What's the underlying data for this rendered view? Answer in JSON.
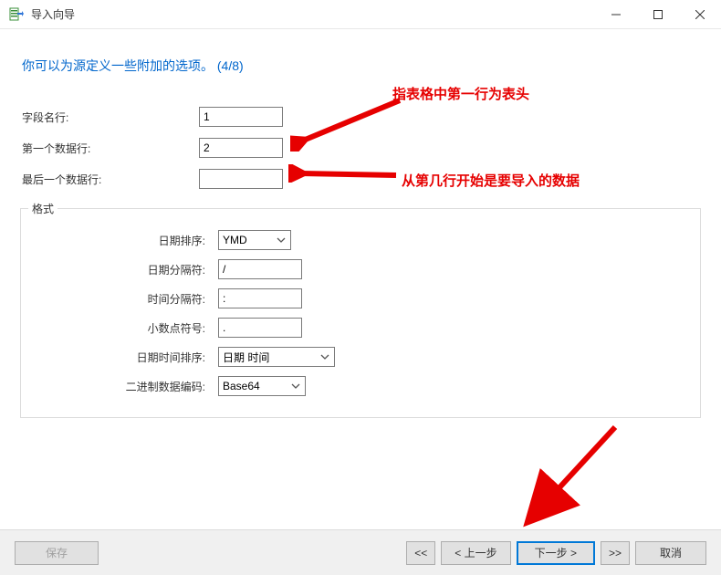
{
  "window": {
    "title": "导入向导"
  },
  "instruction": "你可以为源定义一些附加的选项。 (4/8)",
  "row_config": {
    "field_name_row_label": "字段名行:",
    "field_name_row_value": "1",
    "first_data_row_label": "第一个数据行:",
    "first_data_row_value": "2",
    "last_data_row_label": "最后一个数据行:",
    "last_data_row_value": ""
  },
  "format": {
    "legend": "格式",
    "date_order_label": "日期排序:",
    "date_order_value": "YMD",
    "date_delim_label": "日期分隔符:",
    "date_delim_value": "/",
    "time_delim_label": "时间分隔符:",
    "time_delim_value": ":",
    "decimal_label": "小数点符号:",
    "decimal_value": ".",
    "datetime_order_label": "日期时间排序:",
    "datetime_order_value": "日期 时间",
    "binary_enc_label": "二进制数据编码:",
    "binary_enc_value": "Base64"
  },
  "annotations": {
    "note1": "指表格中第一行为表头",
    "note2": "从第几行开始是要导入的数据"
  },
  "buttons": {
    "save": "保存",
    "first": "<<",
    "prev": "< 上一步",
    "next": "下一步 >",
    "last": ">>",
    "cancel": "取消"
  }
}
